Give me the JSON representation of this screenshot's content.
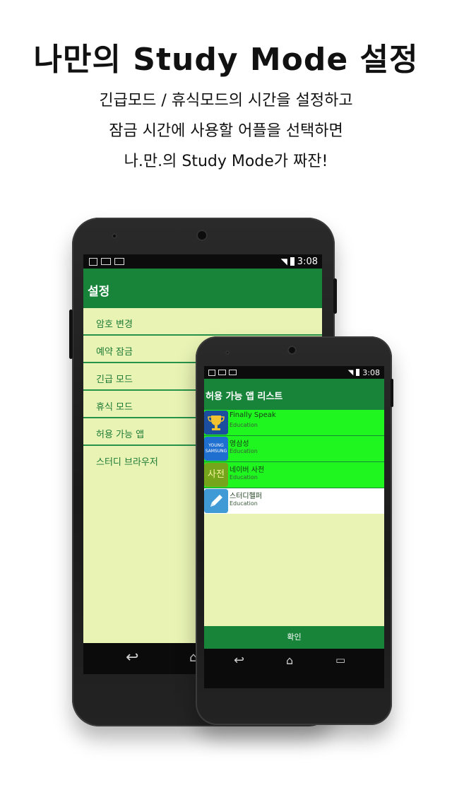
{
  "headline": "나만의 Study Mode 설정",
  "subtitle": {
    "line1": "긴급모드 / 휴식모드의 시간을 설정하고",
    "line2": "잠금 시간에 사용할 어플을 선택하면",
    "line3": "나.만.의 Study Mode가 짜잔!"
  },
  "back_phone": {
    "status_time": "3:08",
    "title": "설정",
    "menu_items": [
      {
        "label": "암호 변경"
      },
      {
        "label": "예약 잠금"
      },
      {
        "label": "긴급 모드"
      },
      {
        "label": "휴식 모드"
      },
      {
        "label": "허용 가능 앱"
      },
      {
        "label": "스터디 브라우저"
      }
    ]
  },
  "front_phone": {
    "status_time": "3:08",
    "title": "허용 가능 앱 리스트",
    "apps": [
      {
        "name": "Finally Speak",
        "category": "Education",
        "selected": true,
        "icon": "trophy-icon"
      },
      {
        "name": "영삼성",
        "category": "Education",
        "selected": true,
        "icon": "young-samsung-icon",
        "icon_text": "YOUNG SAMSUNG"
      },
      {
        "name": "네이버 사전",
        "category": "Education",
        "selected": true,
        "icon": "naver-dictionary-icon",
        "icon_text": "사전"
      },
      {
        "name": "스터디헬퍼",
        "category": "Education",
        "selected": false,
        "icon": "pencil-icon"
      }
    ],
    "confirm_label": "확인"
  },
  "colors": {
    "primary_green": "#17843a",
    "screen_background": "#e8f3b4",
    "selected_row": "#1ff51f",
    "menu_text": "#1d7a36"
  }
}
